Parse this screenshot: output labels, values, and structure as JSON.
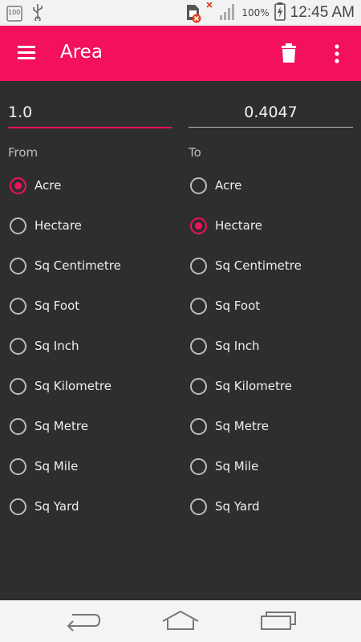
{
  "status_bar": {
    "notification_badge": "100",
    "battery_percent": "100%",
    "time": "12:45 AM",
    "icons": [
      "notification-100-icon",
      "usb-icon",
      "sim-error-icon",
      "no-signal-icon",
      "signal-icon",
      "battery-charging-icon"
    ]
  },
  "app_bar": {
    "title": "Area",
    "icons": [
      "menu-icon",
      "delete-icon",
      "more-vert-icon"
    ],
    "color": "#f2115a"
  },
  "converter": {
    "from_value": "1.0",
    "to_value": "0.4047",
    "from_label": "From",
    "to_label": "To"
  },
  "from_units": [
    {
      "label": "Acre",
      "checked": true
    },
    {
      "label": "Hectare",
      "checked": false
    },
    {
      "label": "Sq Centimetre",
      "checked": false
    },
    {
      "label": "Sq Foot",
      "checked": false
    },
    {
      "label": "Sq Inch",
      "checked": false
    },
    {
      "label": "Sq Kilometre",
      "checked": false
    },
    {
      "label": "Sq Metre",
      "checked": false
    },
    {
      "label": "Sq Mile",
      "checked": false
    },
    {
      "label": "Sq Yard",
      "checked": false
    }
  ],
  "to_units": [
    {
      "label": "Acre",
      "checked": false
    },
    {
      "label": "Hectare",
      "checked": true
    },
    {
      "label": "Sq Centimetre",
      "checked": false
    },
    {
      "label": "Sq Foot",
      "checked": false
    },
    {
      "label": "Sq Inch",
      "checked": false
    },
    {
      "label": "Sq Kilometre",
      "checked": false
    },
    {
      "label": "Sq Metre",
      "checked": false
    },
    {
      "label": "Sq Mile",
      "checked": false
    },
    {
      "label": "Sq Yard",
      "checked": false
    }
  ],
  "nav_bar": {
    "icons": [
      "back-icon",
      "home-icon",
      "recent-apps-icon"
    ]
  }
}
